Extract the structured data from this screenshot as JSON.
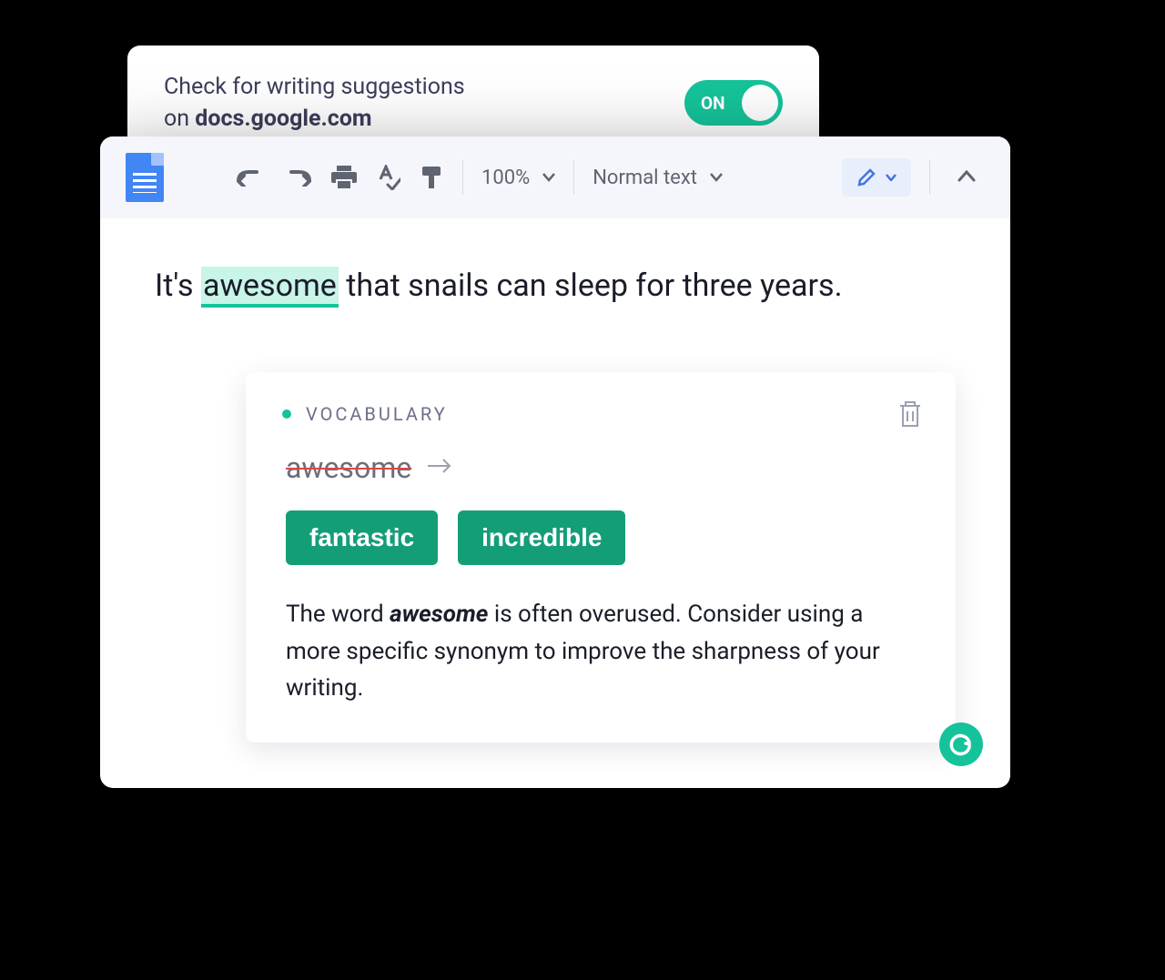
{
  "settings": {
    "line1": "Check for writing suggestions",
    "line2_prefix": "on ",
    "line2_domain": "docs.google.com",
    "toggle_label": "ON"
  },
  "toolbar": {
    "zoom": "100%",
    "paragraph_style": "Normal text"
  },
  "document": {
    "sentence_prefix": "It's ",
    "highlighted_word": "awesome",
    "sentence_suffix": " that snails can sleep for three years."
  },
  "suggestion": {
    "category": "VOCABULARY",
    "original_word": "awesome",
    "replacements": [
      "fantastic",
      "incredible"
    ],
    "explanation_prefix": "The word ",
    "explanation_em": "awesome",
    "explanation_suffix": " is often overused. Consider using a more specific synonym to improve the sharpness of your writing."
  }
}
